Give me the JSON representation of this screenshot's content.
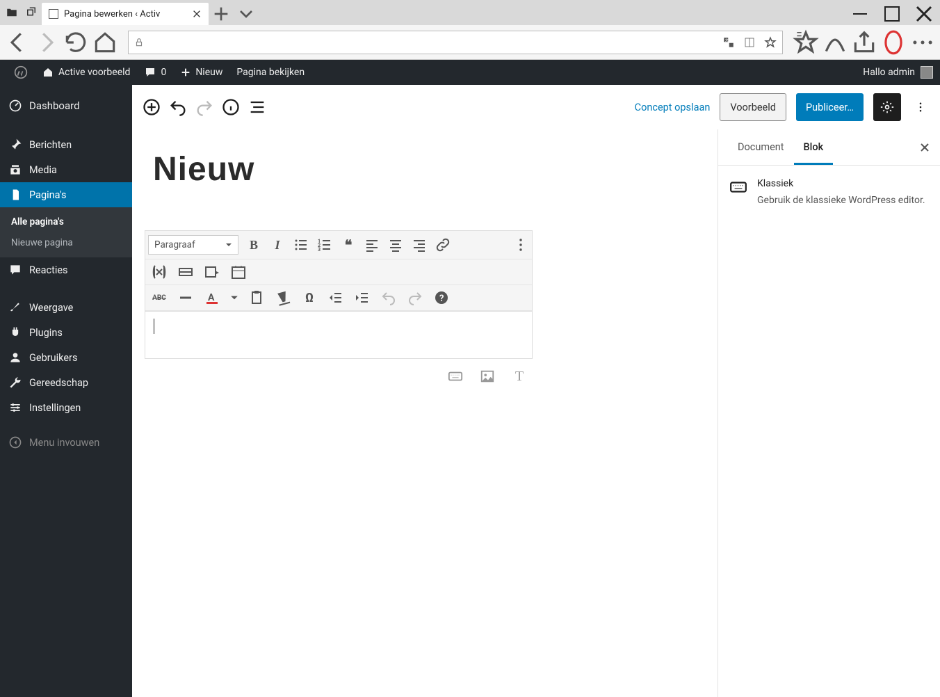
{
  "browser": {
    "tab_title": "Pagina bewerken ‹ Activ"
  },
  "wpbar": {
    "site_name": "Active voorbeeld",
    "comments": "0",
    "new_label": "Nieuw",
    "view_page": "Pagina bekijken",
    "greeting": "Hallo admin"
  },
  "sidebar": {
    "dashboard": "Dashboard",
    "posts": "Berichten",
    "media": "Media",
    "pages": "Pagina's",
    "sub_all": "Alle pagina's",
    "sub_new": "Nieuwe pagina",
    "comments": "Reacties",
    "appearance": "Weergave",
    "plugins": "Plugins",
    "users": "Gebruikers",
    "tools": "Gereedschap",
    "settings": "Instellingen",
    "collapse": "Menu invouwen"
  },
  "editor": {
    "save_draft": "Concept opslaan",
    "preview": "Voorbeeld",
    "publish": "Publiceer…",
    "page_title": "Nieuw",
    "format_select": "Paragraaf"
  },
  "panel": {
    "tab_document": "Document",
    "tab_block": "Blok",
    "block_name": "Klassiek",
    "block_desc": "Gebruik de klassieke WordPress editor."
  }
}
